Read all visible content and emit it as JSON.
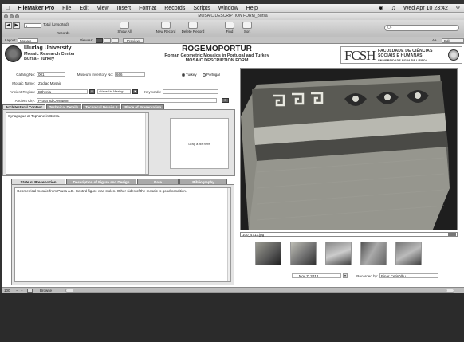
{
  "menubar": {
    "app": "FileMaker Pro",
    "items": [
      "File",
      "Edit",
      "View",
      "Insert",
      "Format",
      "Records",
      "Scripts",
      "Window",
      "Help"
    ],
    "clock": "Wed Apr 10 23:42"
  },
  "window": {
    "title": "MOSAIC DESCRIPTION FORM_Bursa"
  },
  "toolbar": {
    "record_number": "1",
    "total": "Total (Unsorted)",
    "records_label": "Records",
    "show_all": "Show All",
    "new_record": "New Record",
    "delete_record": "Delete Record",
    "find": "Find",
    "sort": "Sort",
    "search_placeholder": "Q-"
  },
  "layoutbar": {
    "layout_label": "Layout:",
    "layout_value": "Mosaic",
    "view_as": "View As:",
    "preview": "Preview",
    "aa": "Aa",
    "edit_layout": "Edit Layout"
  },
  "header": {
    "uni_name": "Uludag University",
    "uni_line2": "Mosaic Research Center",
    "uni_line3": "Bursa - Turkey",
    "project": "ROGEMOPORTUR",
    "project_sub1": "Roman Geometric Mosaics in Portugal and Turkey",
    "project_sub2": "MOSAIC DESCRIPTION FORM",
    "fcsh": "FCSH",
    "fcsh_line1": "FACULDADE DE CIÊNCIAS",
    "fcsh_line2": "SOCIAIS E HUMANAS",
    "fcsh_line3": "UNIVERSIDADE NOVA DE LISBOA"
  },
  "form": {
    "catalog_label": "Catalog No:",
    "catalog_value": "001",
    "museum_label": "Museum Inventory No:",
    "museum_value": "666",
    "country_a": "Turkey",
    "country_b": "Portugal",
    "mosaic_label": "Mosaic Name:",
    "mosaic_value": "Zodiac Mosaic",
    "region_label": "Ancient Region:",
    "region_value": "Bithynia",
    "value_list": "<Value List Missing>",
    "keywords_label": "Keywords:",
    "keywords_value": "",
    "city_label": "Ancient City:",
    "city_value": "Prusa ad Olympum"
  },
  "tabs_top": [
    "Architectural Context",
    "Technical Details",
    "Technical Details II",
    "Place of Preservation"
  ],
  "arch_context_text": "Synagogue at Tophane in Bursa.",
  "dropzone_text": "Drag a file here",
  "tabs_bottom": [
    "State of Preservation",
    "Description of Figure and Design",
    "Date",
    "Bibliography"
  ],
  "state_text": "Geometrical mosaic from Prusa a.D. Central figure was stolen. Other sides of the mosaic is good condition.",
  "photo": {
    "filename": "100_4713.jpg"
  },
  "footer": {
    "date": "Nov 7, 2012",
    "recorded_label": "Recorded by:",
    "recorded_value": "Pinar Çetinöğlu"
  },
  "statusbar": {
    "zoom": "100",
    "mode": "Browse"
  },
  "colors": {
    "accent": "#666666",
    "panel": "#e4e4e4"
  }
}
